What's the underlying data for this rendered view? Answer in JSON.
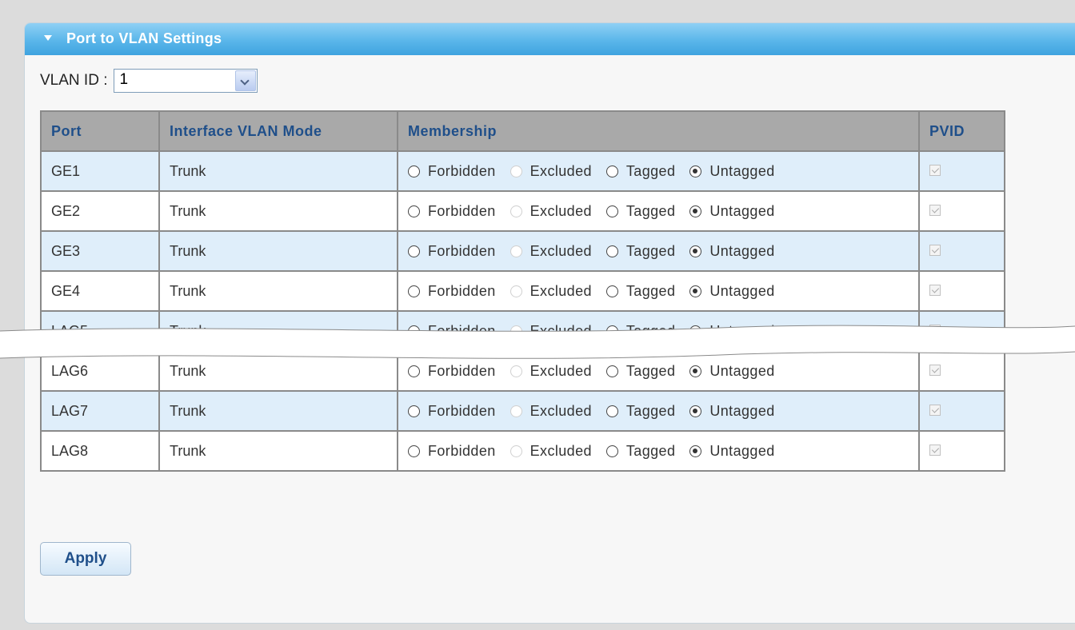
{
  "panel": {
    "title": "Port to VLAN Settings"
  },
  "vlan": {
    "label": "VLAN ID :",
    "selected": "1"
  },
  "table": {
    "headers": [
      "Port",
      "Interface VLAN Mode",
      "Membership",
      "PVID"
    ],
    "membership_options": [
      "Forbidden",
      "Excluded",
      "Tagged",
      "Untagged"
    ],
    "rows": [
      {
        "port": "GE1",
        "mode": "Trunk",
        "membership": "Untagged",
        "pvid": true
      },
      {
        "port": "GE2",
        "mode": "Trunk",
        "membership": "Untagged",
        "pvid": true
      },
      {
        "port": "GE3",
        "mode": "Trunk",
        "membership": "Untagged",
        "pvid": true
      },
      {
        "port": "GE4",
        "mode": "Trunk",
        "membership": "Untagged",
        "pvid": true
      },
      {
        "port": "LAG5",
        "mode": "Trunk",
        "membership": "Untagged",
        "pvid": true
      },
      {
        "port": "LAG6",
        "mode": "Trunk",
        "membership": "Untagged",
        "pvid": true
      },
      {
        "port": "LAG7",
        "mode": "Trunk",
        "membership": "Untagged",
        "pvid": true
      },
      {
        "port": "LAG8",
        "mode": "Trunk",
        "membership": "Untagged",
        "pvid": true
      }
    ]
  },
  "buttons": {
    "apply": "Apply"
  },
  "colors": {
    "header_blue": "#4aabe3",
    "row_alt": "#dfeefa",
    "header_text": "#1f4f8a"
  }
}
